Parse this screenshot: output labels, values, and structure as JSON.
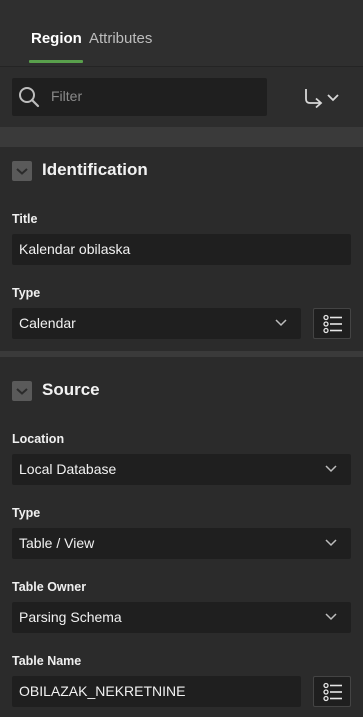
{
  "tabs": [
    {
      "label": "Region",
      "active": true
    },
    {
      "label": "Attributes",
      "active": false
    }
  ],
  "filter": {
    "placeholder": "Filter"
  },
  "icons": {
    "search": "search-icon",
    "go_to_group": "curved-arrow-icon",
    "chevron": "chevron-down-icon",
    "list_of_values": "list-icon"
  },
  "colors": {
    "background": "#2b2b2b",
    "tab_accent": "#59a04c",
    "field_background": "#1f1f1f",
    "text": "#f2f2f2"
  },
  "identification": {
    "title": "Identification",
    "title_label": "Title",
    "title_value": "Kalendar obilaska",
    "type_label": "Type",
    "type_value": "Calendar"
  },
  "source": {
    "title": "Source",
    "location_label": "Location",
    "location_value": "Local Database",
    "type_label": "Type",
    "type_value": "Table / View",
    "table_owner_label": "Table Owner",
    "table_owner_value": "Parsing Schema",
    "table_name_label": "Table Name",
    "table_name_value": "OBILAZAK_NEKRETNINE"
  }
}
